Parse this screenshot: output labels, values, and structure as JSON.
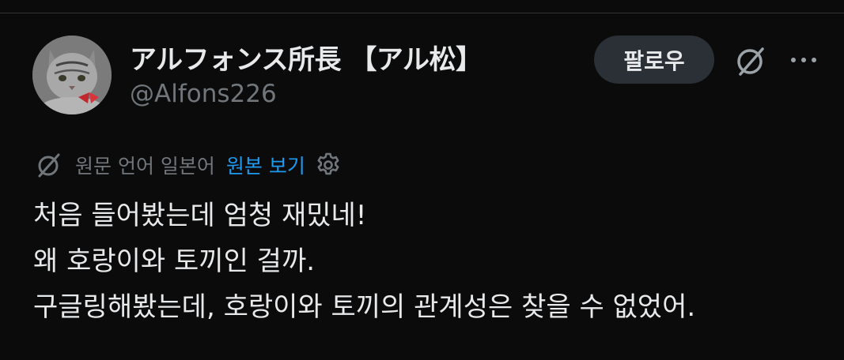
{
  "author": {
    "display_name": "アルフォンス所長 【アル松】",
    "handle": "@Alfons226",
    "avatar_icon": "cat-avatar"
  },
  "header_actions": {
    "follow_label": "팔로우",
    "grok_icon": "grok-icon",
    "more_icon": "more-icon"
  },
  "translation": {
    "language_note": "원문 언어 일본어",
    "show_original_label": "원본 보기",
    "settings_icon": "gear-icon"
  },
  "tweet": {
    "lines": [
      "처음 들어봤는데 엄청 재밌네!",
      "왜 호랑이와 토끼인 걸까.",
      "구글링해봤는데, 호랑이와 토끼의 관계성은 찾을 수 없었어."
    ]
  },
  "colors": {
    "background": "#0b0b0c",
    "primary_text": "#e7e9ea",
    "secondary_text": "#71767b",
    "link": "#1d9bf0",
    "button_bg": "#2b3036"
  }
}
